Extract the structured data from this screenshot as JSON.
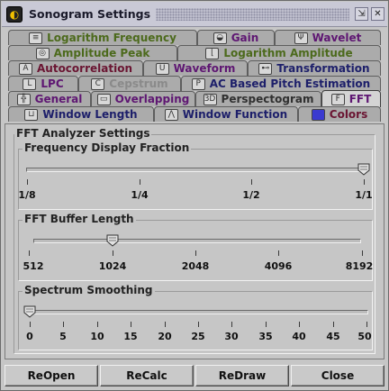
{
  "window": {
    "title": "Sonogram Settings"
  },
  "tabs": {
    "row1": [
      {
        "label": "Logarithm Frequency",
        "icon": "log-frequency-icon",
        "color": "#4c6a1c"
      },
      {
        "label": "Gain",
        "icon": "gain-icon",
        "color": "#5e1672"
      },
      {
        "label": "Wavelet",
        "icon": "wavelet-icon",
        "color": "#5e1672"
      }
    ],
    "row2": [
      {
        "label": "Amplitude Peak",
        "icon": "amplitude-peak-icon",
        "color": "#4c6a1c"
      },
      {
        "label": "Logarithm Amplitude",
        "icon": "log-amplitude-icon",
        "color": "#4c6a1c"
      }
    ],
    "row3": [
      {
        "label": "Autocorrelation",
        "icon": "autocorrelation-icon",
        "color": "#6a1532"
      },
      {
        "label": "Waveform",
        "icon": "waveform-icon",
        "color": "#5e1672"
      },
      {
        "label": "Transformation",
        "icon": "transformation-icon",
        "color": "#1d1f6a"
      }
    ],
    "row4": [
      {
        "label": "LPC",
        "icon": "lpc-icon",
        "color": "#5e1672"
      },
      {
        "label": "Cepstrum",
        "icon": "cepstrum-icon",
        "color": "#8a8a8a"
      },
      {
        "label": "AC Based Pitch Estimation",
        "icon": "pitch-estimation-icon",
        "color": "#1d1f6a"
      }
    ],
    "row5": [
      {
        "label": "General",
        "icon": "general-icon",
        "color": "#5e1672"
      },
      {
        "label": "Overlapping",
        "icon": "overlapping-icon",
        "color": "#5e1672"
      },
      {
        "label": "Perspectogram",
        "icon": "perspectogram-icon",
        "color": "#303030"
      },
      {
        "label": "FFT",
        "icon": "fft-icon",
        "color": "#5e1672",
        "active": true
      }
    ],
    "row6": [
      {
        "label": "Window Length",
        "icon": "window-length-icon",
        "color": "#1d1f6a"
      },
      {
        "label": "Window Function",
        "icon": "window-function-icon",
        "color": "#1d1f6a"
      },
      {
        "label": "Colors",
        "icon": "colors-icon",
        "color": "#6a1532"
      }
    ]
  },
  "fft_panel": {
    "group_title": "FFT Analyzer Settings",
    "frequency_display": {
      "label": "Frequency Display Fraction",
      "ticks": [
        "1/8",
        "1/4",
        "1/2",
        "1/1"
      ],
      "selected": "1/1"
    },
    "buffer_length": {
      "label": "FFT Buffer Length",
      "ticks": [
        "512",
        "1024",
        "2048",
        "4096",
        "8192"
      ],
      "selected": "1024"
    },
    "smoothing": {
      "label": "Spectrum Smoothing",
      "ticks": [
        "0",
        "5",
        "10",
        "15",
        "20",
        "25",
        "30",
        "35",
        "40",
        "45",
        "50"
      ],
      "selected": "0"
    }
  },
  "buttons": {
    "reopen": "ReOpen",
    "recalc": "ReCalc",
    "redraw": "ReDraw",
    "close": "Close"
  }
}
